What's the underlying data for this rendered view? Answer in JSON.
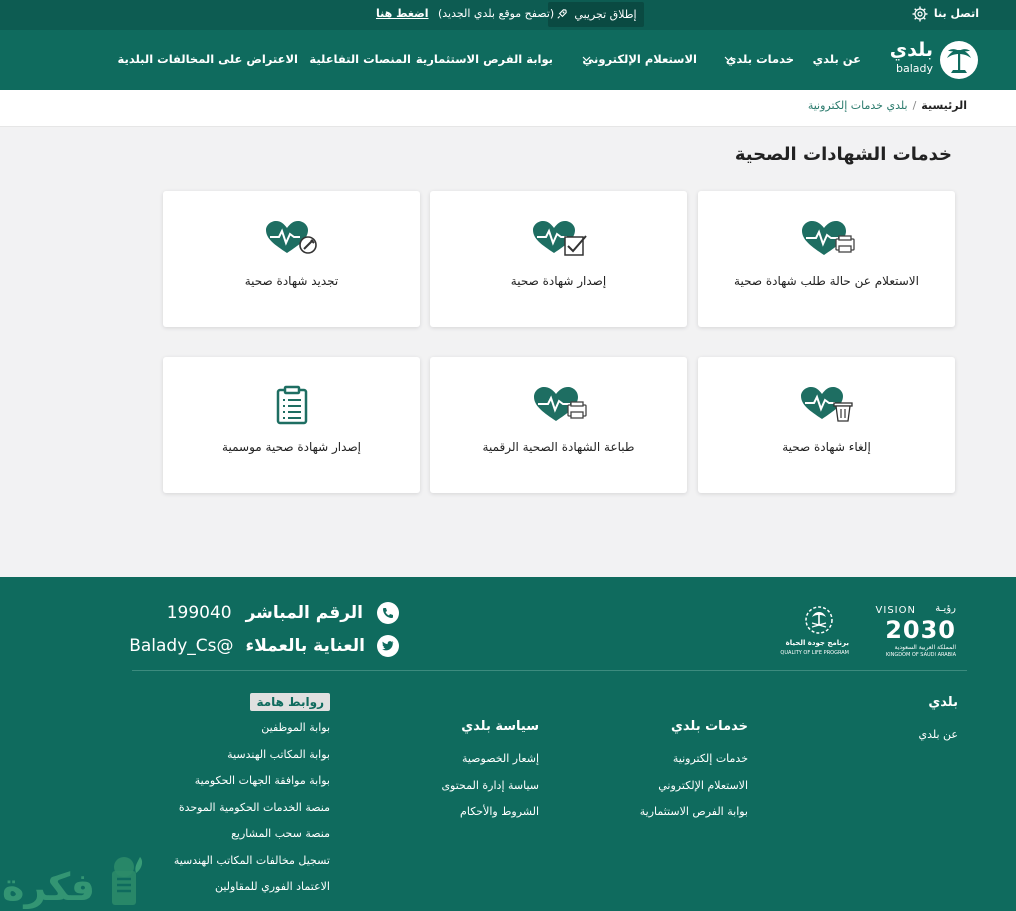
{
  "topbar": {
    "contact": "اتصل بنا",
    "beta_label": "إطلاق تجريبي",
    "notice_text": "(تصفح موقع بلدي الجديد)",
    "notice_link": "اضغط هنا"
  },
  "logo": {
    "arabic": "بلدي",
    "latin": "balady"
  },
  "nav": {
    "items": [
      "عن بلدي",
      "خدمات بلدي",
      "الاستعلام الإلكتروني",
      "بوابة الفرص الاستثمارية",
      "المنصات التفاعلية",
      "الاعتراض على المخالفات البلدية"
    ]
  },
  "breadcrumb": {
    "home": "الرئيسية",
    "separator": "/",
    "current": "بلدي خدمات إلكترونية"
  },
  "page_title": "خدمات الشهادات الصحية",
  "cards": [
    "الاستعلام عن حالة طلب شهادة صحية",
    "إصدار شهادة صحية",
    "تجديد شهادة صحية",
    "إلغاء شهادة صحية",
    "طباعة الشهادة الصحية الرقمية",
    "إصدار شهادة صحية موسمية"
  ],
  "footer": {
    "hotline_label": "الرقم المباشر",
    "hotline_number": "199040",
    "care_label": "العناية بالعملاء",
    "care_handle": "@Balady_Cs",
    "vision_word": "VISION",
    "vision_ar": "رؤيـة",
    "vision_year": "2030",
    "vision_sub": "المملكة العربية السعودية",
    "vision_kingdom": "KINGDOM OF SAUDI ARABIA",
    "qol_ar": "برنامج جودة الحياة",
    "qol_en": "QUALITY OF LIFE PROGRAM",
    "col_balady": {
      "title": "بلدي",
      "items": [
        "عن بلدي"
      ]
    },
    "col_services": {
      "title": "خدمات بلدي",
      "items": [
        "خدمات إلكترونية",
        "الاستعلام الإلكتروني",
        "بوابة الفرص الاستثمارية"
      ]
    },
    "col_policy": {
      "title": "سياسة بلدي",
      "items": [
        "إشعار الخصوصية",
        "سياسة إدارة المحتوى",
        "الشروط والأحكام"
      ]
    },
    "col_links": {
      "title": "روابط هامة",
      "items": [
        "بوابة الموظفين",
        "بوابة المكاتب الهندسية",
        "بوابة موافقة الجهات الحكومية",
        "منصة الخدمات الحكومية الموحدة",
        "منصة سحب المشاريع",
        "تسجيل مخالفات المكاتب الهندسية",
        "الاعتماد الفوري للمقاولين"
      ]
    }
  },
  "watermark": "فكرة",
  "colors": {
    "primary": "#0f6b5e",
    "dark": "#0d5c52",
    "accent": "#1e8a76"
  }
}
